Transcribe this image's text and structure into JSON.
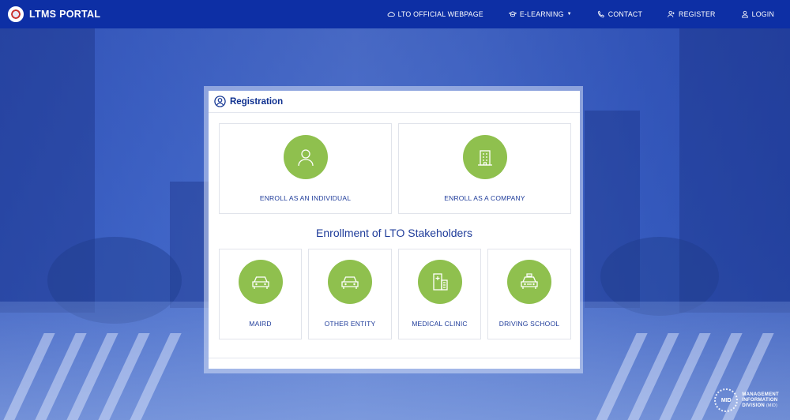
{
  "header": {
    "title": "LTMS PORTAL",
    "nav": [
      {
        "label": "LTO OFFICIAL WEBPAGE",
        "icon": "cloud-icon"
      },
      {
        "label": "E-LEARNING",
        "icon": "graduation-cap-icon",
        "dropdown": true
      },
      {
        "label": "CONTACT",
        "icon": "phone-icon"
      },
      {
        "label": "REGISTER",
        "icon": "user-plus-icon"
      },
      {
        "label": "LOGIN",
        "icon": "user-icon"
      }
    ]
  },
  "registration": {
    "title": "Registration",
    "enroll_individual": "ENROLL AS AN INDIVIDUAL",
    "enroll_company": "ENROLL AS A COMPANY",
    "section_title": "Enrollment of LTO Stakeholders",
    "stakeholders": [
      {
        "label": "MAIRD",
        "icon": "car-icon"
      },
      {
        "label": "OTHER ENTITY",
        "icon": "car-icon"
      },
      {
        "label": "MEDICAL CLINIC",
        "icon": "hospital-icon"
      },
      {
        "label": "DRIVING SCHOOL",
        "icon": "taxi-icon"
      }
    ]
  },
  "footer_logo": {
    "badge": "MID",
    "line1": "MANAGEMENT",
    "line2": "INFORMATION",
    "line3": "DIVISION",
    "suffix": "(MID)"
  },
  "colors": {
    "nav_bg": "#0d2fa5",
    "accent_green": "#8fc04e",
    "title_blue": "#0d2f8f",
    "label_blue": "#1f3c9a"
  }
}
